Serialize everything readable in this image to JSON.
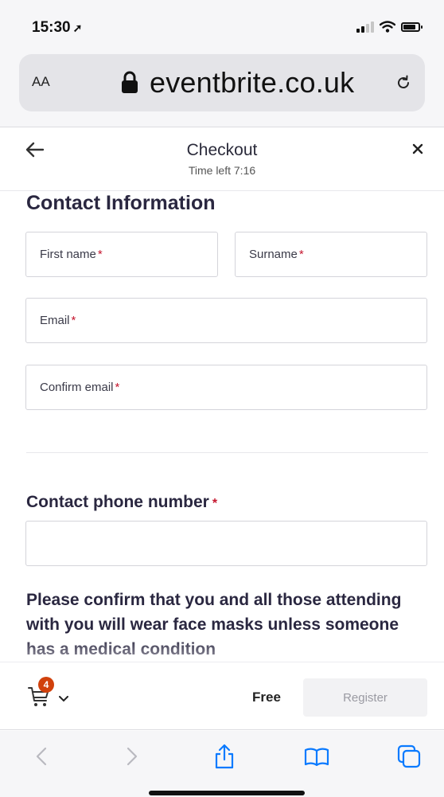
{
  "status_bar": {
    "time": "15:30",
    "location_glyph": "➚"
  },
  "browser": {
    "text_size_label": "AA",
    "url": "eventbrite.co.uk"
  },
  "header": {
    "title": "Checkout",
    "time_left": "Time left 7:16"
  },
  "contact_info": {
    "heading": "Contact Information",
    "first_name_label": "First name",
    "surname_label": "Surname",
    "email_label": "Email",
    "confirm_email_label": "Confirm email",
    "required_marker": "*"
  },
  "phone": {
    "heading": "Contact phone number",
    "required_marker": "*",
    "value": ""
  },
  "mask_notice": {
    "text": "Please confirm that you and all those attending with you will wear face masks unless someone has a medical condition"
  },
  "checkout_bar": {
    "cart_count": "4",
    "price": "Free",
    "register_label": "Register"
  },
  "colors": {
    "accent_orange": "#d1410c",
    "required_red": "#c5162e",
    "ios_blue": "#0a7aff",
    "text_dark": "#2a2740"
  },
  "icons": {
    "back": "arrow-left-icon",
    "close": "close-icon",
    "lock": "lock-icon",
    "reload": "reload-icon",
    "cart": "cart-icon",
    "toolbar": [
      "back-chevron-icon",
      "forward-chevron-icon",
      "share-icon",
      "bookmarks-icon",
      "tabs-icon"
    ]
  }
}
